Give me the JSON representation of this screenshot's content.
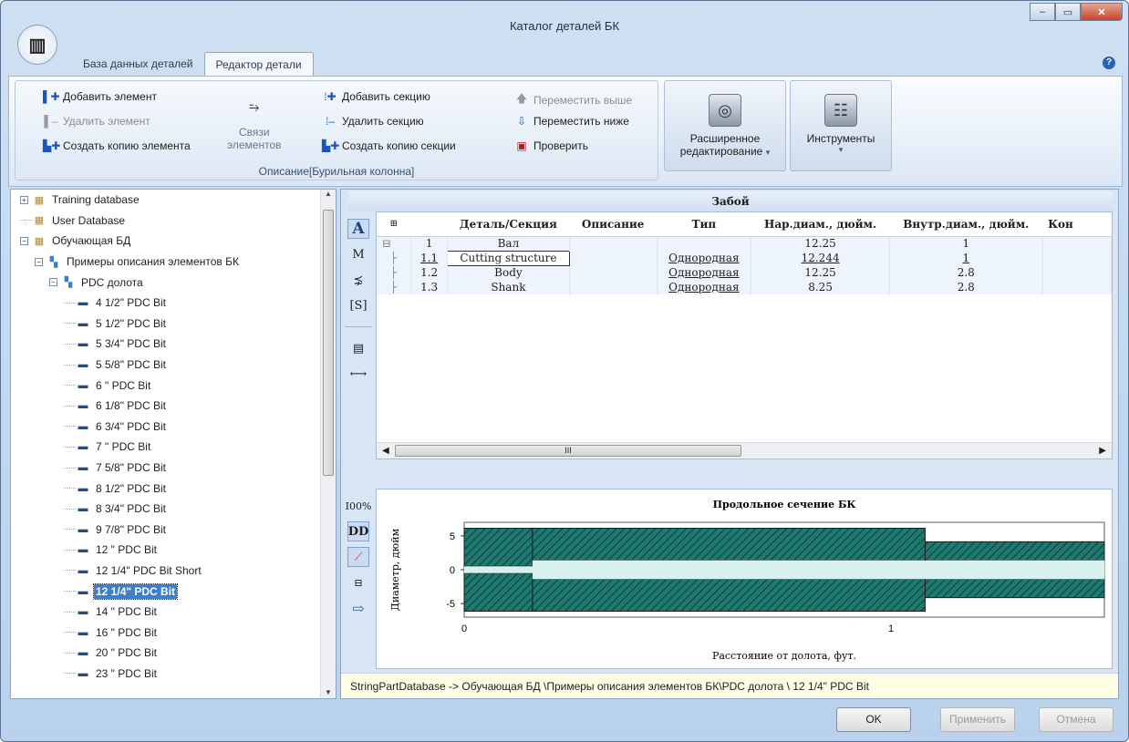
{
  "window": {
    "title": "Каталог деталей БК",
    "app_icon": "drill-string-logo",
    "controls": [
      "minimize-icon",
      "maximize-icon",
      "close-icon"
    ]
  },
  "tabs": [
    {
      "label": "База данных деталей",
      "active": false
    },
    {
      "label": "Редактор детали",
      "active": true
    }
  ],
  "help_icon": "?",
  "ribbon": {
    "group1": {
      "caption": "Описание[Бурильная колонна]",
      "add_element": "Добавить элемент",
      "delete_element": "Удалить элемент",
      "copy_element": "Создать копию элемента",
      "links_line1": "Связи",
      "links_line2": "элементов",
      "add_section": "Добавить секцию",
      "delete_section": "Удалить секцию",
      "copy_section": "Создать копию секции",
      "move_up": "Переместить выше",
      "move_down": "Переместить ниже",
      "check": "Проверить"
    },
    "advanced_line1": "Расширенное",
    "advanced_line2": "редактирование",
    "tools": "Инструменты"
  },
  "tree": {
    "items": [
      {
        "label": "Training database",
        "level": 0,
        "expander": "+",
        "icon": "database-icon"
      },
      {
        "label": "User Database",
        "level": 0,
        "expander": "",
        "icon": "database-icon"
      },
      {
        "label": "Обучающая БД",
        "level": 0,
        "expander": "-",
        "icon": "database-icon"
      },
      {
        "label": "Примеры описания элементов БК",
        "level": 1,
        "expander": "-",
        "icon": "folder-icon"
      },
      {
        "label": "PDC долота",
        "level": 2,
        "expander": "-",
        "icon": "folder-icon"
      },
      {
        "label": "4 1/2\" PDC Bit",
        "level": 3,
        "icon": "part-icon"
      },
      {
        "label": "5 1/2\" PDC Bit",
        "level": 3,
        "icon": "part-icon"
      },
      {
        "label": "5 3/4\" PDC Bit",
        "level": 3,
        "icon": "part-icon"
      },
      {
        "label": "5 5/8\" PDC Bit",
        "level": 3,
        "icon": "part-icon"
      },
      {
        "label": "6 \" PDC Bit",
        "level": 3,
        "icon": "part-icon"
      },
      {
        "label": "6 1/8\" PDC Bit",
        "level": 3,
        "icon": "part-icon"
      },
      {
        "label": "6 3/4\" PDC Bit",
        "level": 3,
        "icon": "part-icon"
      },
      {
        "label": "7 \" PDC Bit",
        "level": 3,
        "icon": "part-icon"
      },
      {
        "label": "7 5/8\" PDC Bit",
        "level": 3,
        "icon": "part-icon"
      },
      {
        "label": "8 1/2\" PDC Bit",
        "level": 3,
        "icon": "part-icon"
      },
      {
        "label": "8 3/4\" PDC Bit",
        "level": 3,
        "icon": "part-icon"
      },
      {
        "label": "9 7/8\" PDC Bit",
        "level": 3,
        "icon": "part-icon"
      },
      {
        "label": "12 \" PDC Bit",
        "level": 3,
        "icon": "part-icon"
      },
      {
        "label": "12 1/4\" PDC Bit Short",
        "level": 3,
        "icon": "part-icon"
      },
      {
        "label": "12 1/4\" PDC Bit",
        "level": 3,
        "icon": "part-icon",
        "selected": true
      },
      {
        "label": "14 \" PDC Bit",
        "level": 3,
        "icon": "part-icon"
      },
      {
        "label": "16 \" PDC Bit",
        "level": 3,
        "icon": "part-icon"
      },
      {
        "label": "20 \" PDC Bit",
        "level": 3,
        "icon": "part-icon"
      },
      {
        "label": "23 \" PDC Bit",
        "level": 3,
        "icon": "part-icon"
      }
    ]
  },
  "grid": {
    "title": "Забой",
    "columns": [
      "Деталь/Секция",
      "Описание",
      "Тип",
      "Нар.диам., дюйм.",
      "Внутр.диам., дюйм.",
      "Кон"
    ],
    "rows": [
      {
        "num": "1",
        "name": "Вал",
        "desc": "",
        "type": "",
        "od": "12.25",
        "id": "1",
        "level": 0
      },
      {
        "num": "1.1",
        "name": "Cutting structure",
        "desc": "",
        "type": "Однородная",
        "od": "12.244",
        "id": "1",
        "level": 1,
        "editing": true
      },
      {
        "num": "1.2",
        "name": "Body",
        "desc": "",
        "type": "Однородная",
        "od": "12.25",
        "id": "2.8",
        "level": 1
      },
      {
        "num": "1.3",
        "name": "Shank",
        "desc": "",
        "type": "Однородная",
        "od": "8.25",
        "id": "2.8",
        "level": 1
      }
    ],
    "scroll_grip": "III"
  },
  "grid_tools": [
    "A",
    "M",
    "⋨",
    "[S]"
  ],
  "chart_tools": [
    "I00%",
    "DD"
  ],
  "chart_data": {
    "type": "area",
    "title": "Продольное сечение БК",
    "xlabel": "Расстояние от долота, фут.",
    "ylabel": "Диаметр, дюйм",
    "xticks": [
      "0",
      "1"
    ],
    "yticks": [
      "5",
      "0",
      "-5"
    ],
    "xlim": [
      0,
      1.5
    ],
    "ylim": [
      -7,
      7
    ],
    "sections": [
      {
        "name": "Cutting structure",
        "x0": 0,
        "x1": 0.16,
        "od": 12.244,
        "id": 1
      },
      {
        "name": "Body",
        "x0": 0.16,
        "x1": 1.08,
        "od": 12.25,
        "id": 2.8
      },
      {
        "name": "Shank",
        "x0": 1.08,
        "x1": 1.5,
        "od": 8.25,
        "id": 2.8
      }
    ],
    "fill_color": "#1e7a70",
    "bore_color": "#d8f0ee"
  },
  "status": "StringPartDatabase -> Обучающая БД \\Примеры описания элементов БК\\PDC долота \\ 12 1/4\" PDC Bit",
  "buttons": {
    "ok": "OK",
    "apply": "Применить",
    "cancel": "Отмена"
  }
}
